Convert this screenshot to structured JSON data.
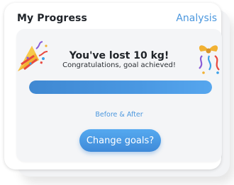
{
  "card": {
    "title": "My Progress",
    "link_label": "Analysis"
  },
  "progress": {
    "headline": "You've lost 10 kg!",
    "subline": "Congratulations, goal achieved!",
    "fill_fraction": 1.0,
    "before_after_label": "Before & After",
    "cta_label": "Change goals?"
  },
  "icons": {
    "left": "party-popper-icon",
    "right": "party-popper-icon"
  },
  "colors": {
    "accent": "#4b97de",
    "progress_fill": "#4a98e2",
    "progress_track": "#dfe6ee",
    "card_bg": "#ffffff",
    "inner_bg": "#f4f5f7"
  }
}
